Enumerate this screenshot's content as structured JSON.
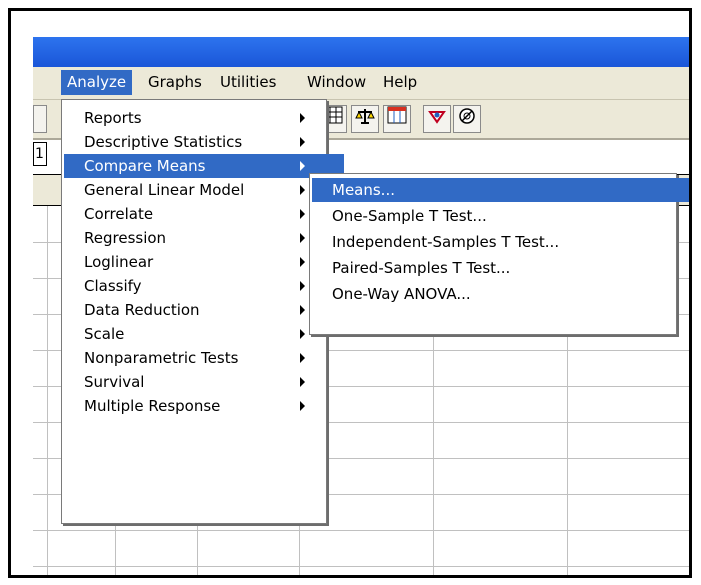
{
  "menubar": {
    "items": [
      {
        "label": "Analyze"
      },
      {
        "label": "Graphs"
      },
      {
        "label": "Utilities"
      },
      {
        "label": "Window"
      },
      {
        "label": "Help"
      }
    ]
  },
  "cell_reference": "1",
  "analyze_menu": {
    "items": [
      {
        "label": "Reports"
      },
      {
        "label": "Descriptive Statistics"
      },
      {
        "label": "Compare Means"
      },
      {
        "label": "General Linear Model"
      },
      {
        "label": "Correlate"
      },
      {
        "label": "Regression"
      },
      {
        "label": "Loglinear"
      },
      {
        "label": "Classify"
      },
      {
        "label": "Data Reduction"
      },
      {
        "label": "Scale"
      },
      {
        "label": "Nonparametric Tests"
      },
      {
        "label": "Survival"
      },
      {
        "label": "Multiple Response"
      }
    ],
    "highlighted": "Compare Means"
  },
  "compare_means_submenu": {
    "items": [
      {
        "label": "Means..."
      },
      {
        "label": "One-Sample T Test..."
      },
      {
        "label": "Independent-Samples T Test..."
      },
      {
        "label": "Paired-Samples T Test..."
      },
      {
        "label": "One-Way ANOVA..."
      }
    ],
    "highlighted": "Means..."
  },
  "toolbar_icons": [
    "data-grid-icon",
    "scale-balance-icon",
    "split-file-icon",
    "select-cases-icon",
    "value-labels-icon"
  ],
  "colors": {
    "titlebar": "#1a56d8",
    "highlight": "#316ac5",
    "chrome": "#ece9d8"
  }
}
